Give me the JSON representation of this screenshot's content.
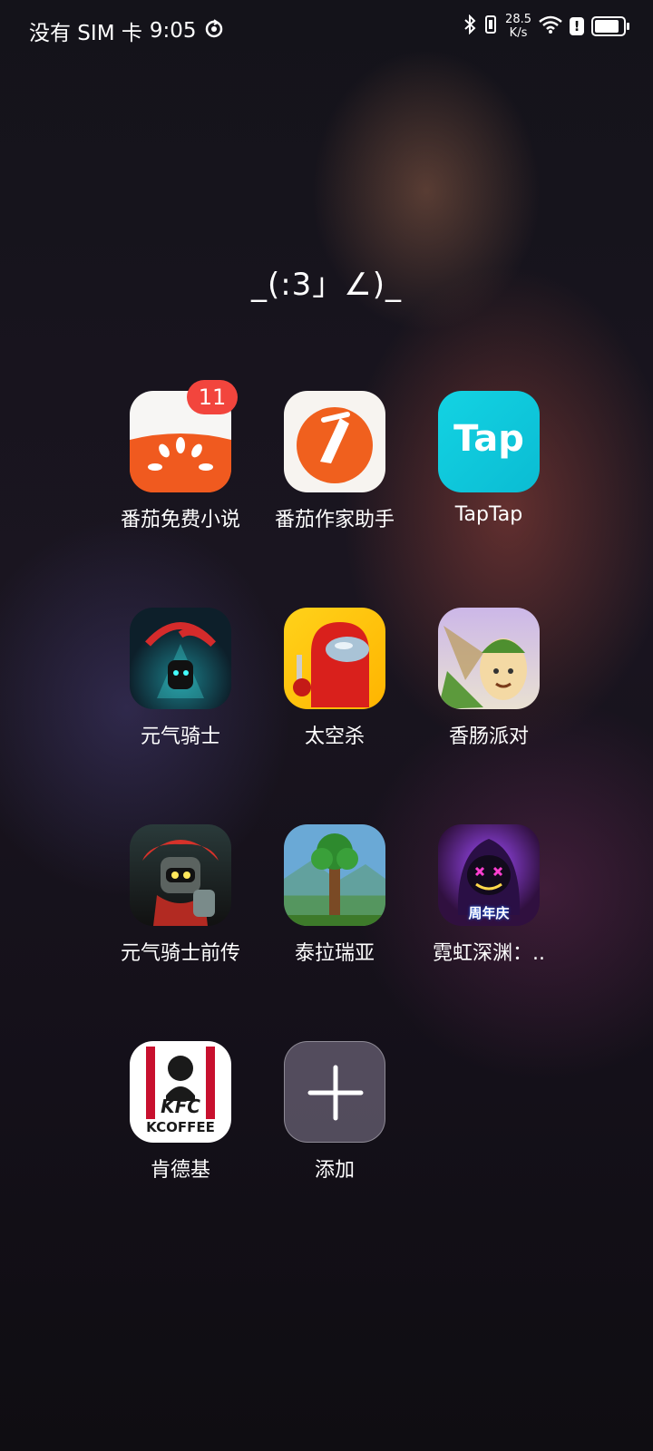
{
  "status_bar": {
    "carrier": "没有 SIM 卡",
    "time": "9:05",
    "net_speed_value": "28.5",
    "net_speed_unit": "K/s",
    "alert": "!",
    "battery_level": 0.85
  },
  "folder": {
    "title": "_(:3」∠)_",
    "apps": [
      {
        "label": "番茄免费小说",
        "badge": "11",
        "icon": "fanqie-novel-icon"
      },
      {
        "label": "番茄作家助手",
        "icon": "fanqie-writer-icon"
      },
      {
        "label": "TapTap",
        "icon_text": "Tap",
        "icon": "taptap-icon"
      },
      {
        "label": "元气骑士",
        "icon": "soul-knight-icon"
      },
      {
        "label": "太空杀",
        "icon": "among-us-icon"
      },
      {
        "label": "香肠派对",
        "icon": "sausage-man-icon"
      },
      {
        "label": "元气骑士前传",
        "icon": "soul-knight-prequel-icon"
      },
      {
        "label": "泰拉瑞亚",
        "icon": "terraria-icon"
      },
      {
        "label": "霓虹深渊：..",
        "icon_text": "周年庆",
        "icon": "neon-abyss-icon"
      },
      {
        "label": "肯德基",
        "icon_text": "KFC",
        "icon_subtext": "KCOFFEE",
        "icon": "kfc-icon"
      },
      {
        "label": "添加",
        "icon": "plus-icon"
      }
    ]
  }
}
